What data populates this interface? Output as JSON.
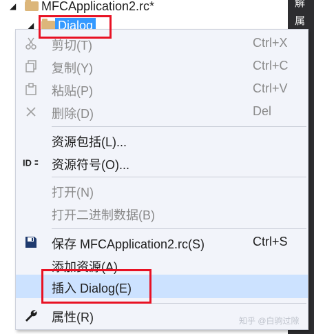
{
  "tree": {
    "root_label": "MFCApplication2.rc*",
    "child_label": "Dialog",
    "expand_glyph": "◢"
  },
  "side_panel": {
    "tab1": "解",
    "tab2": "属"
  },
  "context_menu": {
    "items": [
      {
        "label": "剪切(T)",
        "shortcut": "Ctrl+X",
        "icon": "cut-icon",
        "enabled": false
      },
      {
        "label": "复制(Y)",
        "shortcut": "Ctrl+C",
        "icon": "copy-icon",
        "enabled": false
      },
      {
        "label": "粘贴(P)",
        "shortcut": "Ctrl+V",
        "icon": "paste-icon",
        "enabled": false
      },
      {
        "label": "删除(D)",
        "shortcut": "Del",
        "icon": "delete-icon",
        "enabled": false
      },
      {
        "label": "资源包括(L)...",
        "shortcut": "",
        "icon": "",
        "enabled": true
      },
      {
        "label": "资源符号(O)...",
        "shortcut": "",
        "icon": "id-symbol-icon",
        "enabled": true
      },
      {
        "label": "打开(N)",
        "shortcut": "",
        "icon": "",
        "enabled": false
      },
      {
        "label": "打开二进制数据(B)",
        "shortcut": "",
        "icon": "",
        "enabled": false
      },
      {
        "label": "保存 MFCApplication2.rc(S)",
        "shortcut": "Ctrl+S",
        "icon": "save-icon",
        "enabled": true
      },
      {
        "label": "添加资源(A)...",
        "shortcut": "",
        "icon": "",
        "enabled": true
      },
      {
        "label": "插入 Dialog(E)",
        "shortcut": "",
        "icon": "",
        "enabled": true,
        "highlighted": true
      },
      {
        "label": "属性(R)",
        "shortcut": "",
        "icon": "wrench-icon",
        "enabled": true
      }
    ]
  },
  "watermark": "知乎 @白驹过隙",
  "colors": {
    "menu_bg": "#f2f4fa",
    "highlight": "#cce2ff",
    "selection": "#3399ff",
    "annotation_red": "#e81123",
    "disabled_text": "#8a8a8a",
    "side_panel": "#2d2d30"
  }
}
